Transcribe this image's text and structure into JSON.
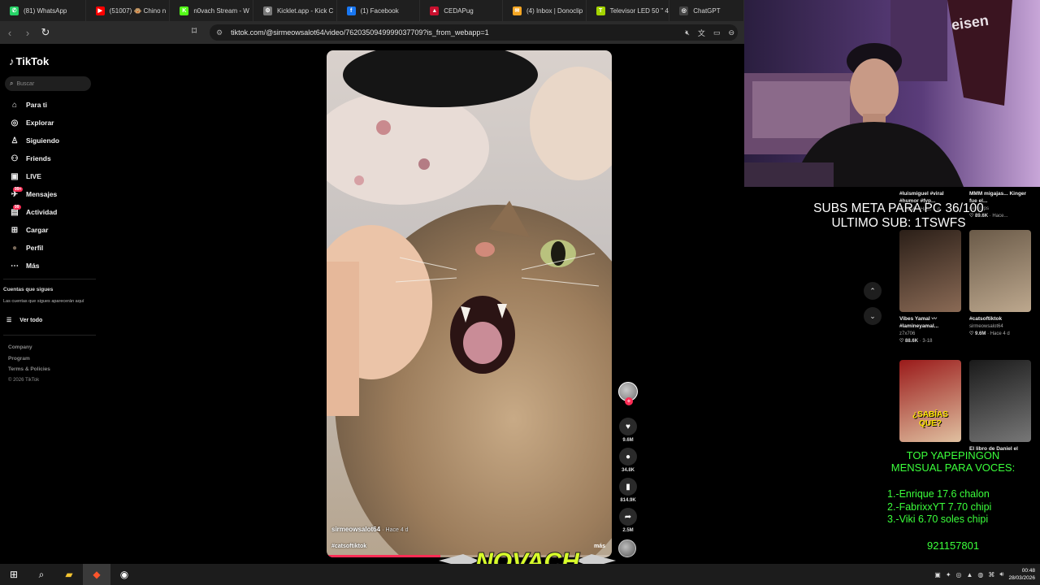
{
  "browser": {
    "tabs": [
      {
        "label": "(81) WhatsApp",
        "color": "#25d366",
        "glyph": "✆"
      },
      {
        "label": "(51007) 🐵 Chino n",
        "color": "#ff0000",
        "glyph": "▶"
      },
      {
        "label": "n0vach Stream - W",
        "color": "#53fc18",
        "glyph": "K"
      },
      {
        "label": "Kicklet.app - Kick C",
        "color": "#7a7a7a",
        "glyph": "⚙"
      },
      {
        "label": "(1) Facebook",
        "color": "#1877f2",
        "glyph": "f"
      },
      {
        "label": "CEDAPug",
        "color": "#c8102e",
        "glyph": "▲"
      },
      {
        "label": "(4) Inbox | Donoclip",
        "color": "#f5a623",
        "glyph": "✉"
      },
      {
        "label": "Televisor LED 50 \" 4",
        "color": "#a4d400",
        "glyph": "T"
      },
      {
        "label": "ChatGPT",
        "color": "#444",
        "glyph": "◎"
      }
    ],
    "url": "tiktok.com/@sirmeowsalot64/video/7620350949999037709?is_from_webapp=1"
  },
  "tiktok": {
    "logo": "TikTok",
    "search_placeholder": "Buscar",
    "nav": [
      {
        "label": "Para ti",
        "icon": "home-icon",
        "glyph": "⌂",
        "badge": ""
      },
      {
        "label": "Explorar",
        "icon": "compass-icon",
        "glyph": "◎",
        "badge": ""
      },
      {
        "label": "Siguiendo",
        "icon": "following-icon",
        "glyph": "♙",
        "badge": ""
      },
      {
        "label": "Friends",
        "icon": "friends-icon",
        "glyph": "⚇",
        "badge": ""
      },
      {
        "label": "LIVE",
        "icon": "live-icon",
        "glyph": "▣",
        "badge": ""
      },
      {
        "label": "Mensajes",
        "icon": "messages-icon",
        "glyph": "✈",
        "badge": "99+"
      },
      {
        "label": "Actividad",
        "icon": "activity-icon",
        "glyph": "▤",
        "badge": "99"
      },
      {
        "label": "Cargar",
        "icon": "upload-icon",
        "glyph": "⊞",
        "badge": ""
      },
      {
        "label": "Perfil",
        "icon": "profile-avatar",
        "glyph": "●",
        "badge": ""
      },
      {
        "label": "Más",
        "icon": "more-icon",
        "glyph": "⋯",
        "badge": ""
      }
    ],
    "following_title": "Cuentas que sigues",
    "following_desc": "Las cuentas que sigues aparecerán aquí",
    "see_all": "Ver todo",
    "footer": [
      "Company",
      "Program",
      "Terms & Policies"
    ],
    "copyright": "© 2026 TikTok"
  },
  "video": {
    "author": "sirmeowsalot64",
    "when": "· Hace 4 d",
    "hashtag": "#catsoftiktok",
    "more": "más",
    "progress": 0.4,
    "actions": [
      {
        "name": "like-button",
        "icon": "heart-icon",
        "glyph": "♥",
        "count": "9.6M"
      },
      {
        "name": "comment-button",
        "icon": "comment-icon",
        "glyph": "●",
        "count": "34.8K"
      },
      {
        "name": "save-button",
        "icon": "bookmark-icon",
        "glyph": "▮",
        "count": "814.9K"
      },
      {
        "name": "share-button",
        "icon": "share-icon",
        "glyph": "➦",
        "count": "2.5M"
      }
    ]
  },
  "overlay": {
    "subs_line1": "SUBS META PARA PC 36/100",
    "subs_line2": "ULTIMO SUB: 1TSWFS",
    "top_title1": "TOP YAPEPINGON",
    "top_title2": "MENSUAL PARA VOCES:",
    "top_list": [
      "1.-Enrique 17.6 chalon",
      "2.-FabrixxYT 7.70 chipi",
      "3.-Viki 6.70 soles chipi"
    ],
    "phone": "921157801",
    "banner": "NOVACH"
  },
  "related": [
    {
      "title": "#luismiguel #viral #humor #fyp...",
      "author": "",
      "likes": "9016",
      "age": "· Hace 1 d"
    },
    {
      "title": "MMM migajas... Kinger fue el...",
      "author": "randclips",
      "likes": "89.6K",
      "age": "· Hace..."
    },
    {
      "title": "Vibes Yamal 〰 #lamineyamal...",
      "author": "z7x706",
      "likes": "88.6K",
      "age": "· 3-18"
    },
    {
      "title": "#catsoftiktok",
      "author": "sirmeowsalot64",
      "likes": "9.6M",
      "age": "· Hace 4 d"
    },
    {
      "title": "¿SABÍAS QUE?",
      "author": "",
      "likes": "",
      "age": ""
    },
    {
      "title": "El libro de Daniel el",
      "author": "",
      "likes": "",
      "age": ""
    }
  ],
  "taskbar": {
    "time": "00:48",
    "date": "28/03/2026"
  }
}
